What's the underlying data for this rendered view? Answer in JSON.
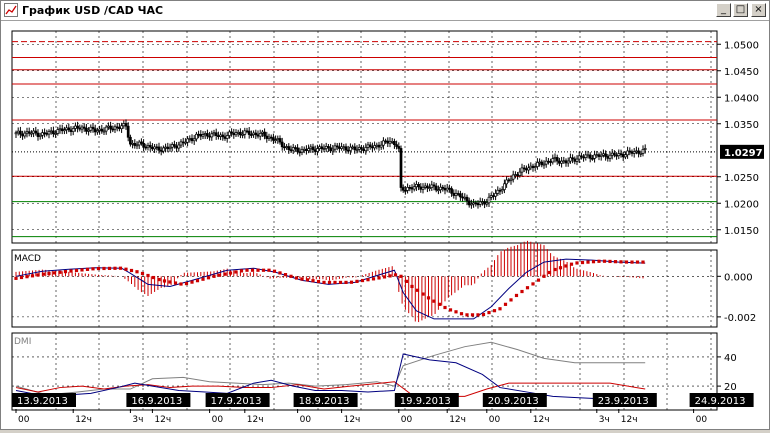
{
  "window": {
    "title": "График USD /CAD  ЧАС",
    "min_glyph": "_",
    "max_glyph": "□",
    "close_glyph": "×"
  },
  "chart_data": [
    {
      "type": "candlestick",
      "name": "USD/CAD hourly",
      "ylim": [
        1.0125,
        1.0525
      ],
      "y_ticks": [
        "1.0500",
        "1.0450",
        "1.0400",
        "1.0350",
        "1.0250",
        "1.0200",
        "1.0150"
      ],
      "y_tick_values": [
        1.05,
        1.045,
        1.04,
        1.035,
        1.025,
        1.02,
        1.015
      ],
      "last_price_label": "1.0297",
      "last_price": 1.0297,
      "levels": [
        {
          "value": 1.0505,
          "color": "#cc0000",
          "style": "dashed"
        },
        {
          "value": 1.0475,
          "color": "#cc0000",
          "style": "solid"
        },
        {
          "value": 1.0452,
          "color": "#cc0000",
          "style": "solid"
        },
        {
          "value": 1.0425,
          "color": "#cc0000",
          "style": "solid"
        },
        {
          "value": 1.0357,
          "color": "#cc0000",
          "style": "solid"
        },
        {
          "value": 1.0297,
          "color": "#000000",
          "style": "dotted"
        },
        {
          "value": 1.0251,
          "color": "#cc0000",
          "style": "solid"
        },
        {
          "value": 1.0203,
          "color": "#008000",
          "style": "solid"
        },
        {
          "value": 1.0137,
          "color": "#008000",
          "style": "solid"
        }
      ],
      "price_path": [
        [
          0,
          1.0331
        ],
        [
          6,
          1.0333
        ],
        [
          12,
          1.033
        ],
        [
          18,
          1.0336
        ],
        [
          24,
          1.034
        ],
        [
          30,
          1.0342
        ],
        [
          36,
          1.0337
        ],
        [
          42,
          1.0341
        ],
        [
          48,
          1.0345
        ],
        [
          50,
          1.0345
        ],
        [
          52,
          1.0312
        ],
        [
          58,
          1.031
        ],
        [
          64,
          1.0302
        ],
        [
          70,
          1.0305
        ],
        [
          76,
          1.0314
        ],
        [
          82,
          1.0327
        ],
        [
          88,
          1.033
        ],
        [
          94,
          1.0326
        ],
        [
          100,
          1.0333
        ],
        [
          106,
          1.0332
        ],
        [
          112,
          1.0329
        ],
        [
          118,
          1.032
        ],
        [
          124,
          1.0302
        ],
        [
          130,
          1.03
        ],
        [
          136,
          1.0303
        ],
        [
          142,
          1.0304
        ],
        [
          148,
          1.0305
        ],
        [
          154,
          1.0302
        ],
        [
          160,
          1.0305
        ],
        [
          166,
          1.0311
        ],
        [
          170,
          1.0318
        ],
        [
          173,
          1.031
        ],
        [
          174,
          1.03
        ],
        [
          175,
          1.0225
        ],
        [
          178,
          1.0229
        ],
        [
          184,
          1.0231
        ],
        [
          190,
          1.023
        ],
        [
          196,
          1.0226
        ],
        [
          202,
          1.0213
        ],
        [
          208,
          1.0197
        ],
        [
          214,
          1.0204
        ],
        [
          220,
          1.0226
        ],
        [
          226,
          1.0252
        ],
        [
          232,
          1.0266
        ],
        [
          238,
          1.0274
        ],
        [
          244,
          1.0282
        ],
        [
          250,
          1.0278
        ],
        [
          256,
          1.0287
        ],
        [
          262,
          1.0289
        ],
        [
          268,
          1.029
        ],
        [
          274,
          1.0291
        ],
        [
          280,
          1.0296
        ],
        [
          286,
          1.0299
        ]
      ]
    },
    {
      "type": "macd",
      "label": "MACD",
      "ylim": [
        -0.0024,
        0.0011
      ],
      "y_ticks": [
        "0.000",
        "-0.002"
      ],
      "y_tick_values": [
        0.0,
        -0.002
      ],
      "histogram_color": "#cc0000",
      "signal_color": "#cc0000",
      "macd_line_color": "#000080",
      "macd_line": [
        [
          0,
          0.0
        ],
        [
          12,
          0.00025
        ],
        [
          24,
          0.00035
        ],
        [
          36,
          0.00042
        ],
        [
          48,
          0.0004
        ],
        [
          52,
          0.00015
        ],
        [
          60,
          -0.0004
        ],
        [
          70,
          -0.0005
        ],
        [
          80,
          -0.0002
        ],
        [
          96,
          0.0003
        ],
        [
          108,
          0.0004
        ],
        [
          118,
          0.0002
        ],
        [
          130,
          -0.0002
        ],
        [
          142,
          -0.0004
        ],
        [
          154,
          -0.0003
        ],
        [
          166,
          0.0001
        ],
        [
          172,
          0.0003
        ],
        [
          176,
          -0.0008
        ],
        [
          182,
          -0.0017
        ],
        [
          190,
          -0.0021
        ],
        [
          198,
          -0.0021
        ],
        [
          208,
          -0.0021
        ],
        [
          216,
          -0.0015
        ],
        [
          224,
          -0.0006
        ],
        [
          232,
          0.0002
        ],
        [
          240,
          0.0007
        ],
        [
          250,
          0.00085
        ],
        [
          262,
          0.0008
        ],
        [
          274,
          0.0007
        ],
        [
          286,
          0.00065
        ]
      ],
      "signal_line": [
        [
          0,
          -0.0001
        ],
        [
          12,
          0.0001
        ],
        [
          24,
          0.00025
        ],
        [
          36,
          0.00038
        ],
        [
          48,
          0.0004
        ],
        [
          56,
          0.0002
        ],
        [
          66,
          -0.0002
        ],
        [
          76,
          -0.0004
        ],
        [
          90,
          0.0
        ],
        [
          104,
          0.0003
        ],
        [
          116,
          0.0003
        ],
        [
          128,
          -0.0001
        ],
        [
          140,
          -0.0003
        ],
        [
          152,
          -0.0003
        ],
        [
          164,
          -0.0001
        ],
        [
          174,
          0.0001
        ],
        [
          180,
          -0.0005
        ],
        [
          188,
          -0.0011
        ],
        [
          196,
          -0.0016
        ],
        [
          204,
          -0.0019
        ],
        [
          212,
          -0.0019
        ],
        [
          220,
          -0.0016
        ],
        [
          228,
          -0.0009
        ],
        [
          236,
          -0.0003
        ],
        [
          244,
          0.0003
        ],
        [
          254,
          0.00065
        ],
        [
          266,
          0.00075
        ],
        [
          278,
          0.0007
        ],
        [
          286,
          0.0007
        ]
      ]
    },
    {
      "type": "dmi",
      "label": "DMI",
      "ylim": [
        5,
        55
      ],
      "y_ticks": [
        "40",
        "20"
      ],
      "y_tick_values": [
        40,
        20
      ],
      "adx_color": "#808080",
      "plus_di_color": "#cc0000",
      "minus_di_color": "#000080",
      "adx": [
        [
          0,
          20
        ],
        [
          14,
          14
        ],
        [
          28,
          16
        ],
        [
          40,
          18
        ],
        [
          52,
          18
        ],
        [
          62,
          25
        ],
        [
          76,
          26
        ],
        [
          88,
          23
        ],
        [
          100,
          22
        ],
        [
          112,
          21
        ],
        [
          124,
          22
        ],
        [
          136,
          20
        ],
        [
          150,
          21
        ],
        [
          164,
          23
        ],
        [
          172,
          20
        ],
        [
          176,
          34
        ],
        [
          190,
          41
        ],
        [
          204,
          47
        ],
        [
          216,
          50
        ],
        [
          228,
          45
        ],
        [
          240,
          39
        ],
        [
          254,
          36
        ],
        [
          266,
          36
        ],
        [
          280,
          36
        ],
        [
          286,
          36
        ]
      ],
      "plus_di": [
        [
          0,
          19
        ],
        [
          10,
          16
        ],
        [
          20,
          19
        ],
        [
          30,
          20
        ],
        [
          40,
          18
        ],
        [
          50,
          20
        ],
        [
          60,
          21
        ],
        [
          70,
          19
        ],
        [
          80,
          20
        ],
        [
          92,
          20
        ],
        [
          104,
          19
        ],
        [
          116,
          19
        ],
        [
          128,
          21
        ],
        [
          140,
          18
        ],
        [
          152,
          20
        ],
        [
          166,
          22
        ],
        [
          172,
          23
        ],
        [
          180,
          14
        ],
        [
          192,
          13
        ],
        [
          204,
          13
        ],
        [
          214,
          18
        ],
        [
          224,
          22
        ],
        [
          234,
          22
        ],
        [
          246,
          22
        ],
        [
          258,
          22
        ],
        [
          270,
          22
        ],
        [
          286,
          18
        ]
      ],
      "minus_di": [
        [
          0,
          17
        ],
        [
          14,
          13
        ],
        [
          24,
          14
        ],
        [
          34,
          15
        ],
        [
          46,
          19
        ],
        [
          54,
          22
        ],
        [
          62,
          20
        ],
        [
          74,
          17
        ],
        [
          86,
          16
        ],
        [
          96,
          15
        ],
        [
          108,
          22
        ],
        [
          116,
          24
        ],
        [
          126,
          20
        ],
        [
          136,
          17
        ],
        [
          148,
          17
        ],
        [
          160,
          16
        ],
        [
          172,
          17
        ],
        [
          176,
          42
        ],
        [
          188,
          38
        ],
        [
          200,
          36
        ],
        [
          212,
          28
        ],
        [
          220,
          19
        ],
        [
          232,
          16
        ],
        [
          244,
          13
        ],
        [
          256,
          12
        ],
        [
          270,
          11
        ],
        [
          286,
          10
        ]
      ]
    }
  ],
  "x_axis": {
    "date_labels": [
      "13.9.2013",
      "16.9.2013",
      "17.9.2013",
      "18.9.2013",
      "19.9.2013",
      "20.9.2013",
      "23.9.2013",
      "24.9.2013"
    ],
    "date_x": [
      0,
      52,
      88,
      128,
      174,
      214,
      264,
      308
    ],
    "hour_labels": [
      {
        "x": 0,
        "text": "00"
      },
      {
        "x": 26,
        "text": "12ч"
      },
      {
        "x": 52,
        "text": "3ч"
      },
      {
        "x": 62,
        "text": "12ч"
      },
      {
        "x": 88,
        "text": "00"
      },
      {
        "x": 104,
        "text": "12ч"
      },
      {
        "x": 128,
        "text": "00"
      },
      {
        "x": 148,
        "text": "12ч"
      },
      {
        "x": 174,
        "text": "00"
      },
      {
        "x": 196,
        "text": "12ч"
      },
      {
        "x": 214,
        "text": "00"
      },
      {
        "x": 234,
        "text": "12ч"
      },
      {
        "x": 264,
        "text": "3ч"
      },
      {
        "x": 274,
        "text": "12ч"
      },
      {
        "x": 308,
        "text": "00"
      }
    ]
  }
}
